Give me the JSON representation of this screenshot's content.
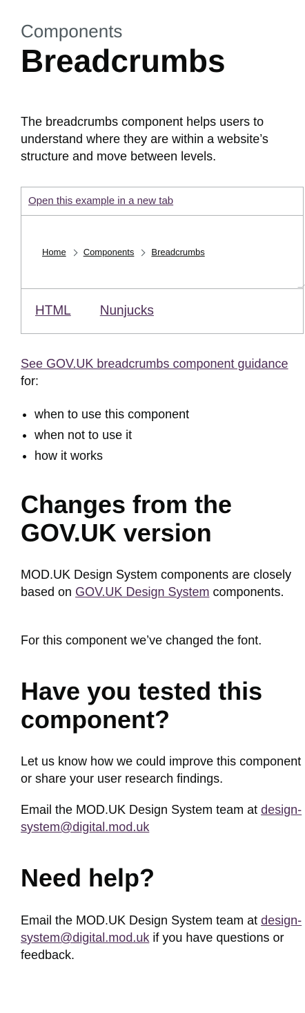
{
  "header": {
    "caption": "Components",
    "title": "Breadcrumbs"
  },
  "intro": "The breadcrumbs component helps users to understand where they are within a website’s structure and move between levels.",
  "example": {
    "open_link": "Open this example in a new tab",
    "breadcrumbs": [
      "Home",
      "Components",
      "Breadcrumbs"
    ],
    "tabs": [
      "HTML",
      "Nunjucks"
    ]
  },
  "guidance": {
    "link": "See GOV.UK breadcrumbs component guidance",
    "suffix": "for:",
    "bullets": [
      "when to use this component",
      "when not to use it",
      "how it works"
    ]
  },
  "changes": {
    "heading": "Changes from the GOV.UK version",
    "para1_before": "MOD.UK Design System components are closely based on ",
    "para1_link": "GOV.UK Design System",
    "para1_after": " components.",
    "para2": "For this component we’ve changed the font."
  },
  "tested": {
    "heading": "Have you tested this component?",
    "para1": "Let us know how we could improve this component or share your user research findings.",
    "para2_before": "Email the MOD.UK Design System team at ",
    "email": "design-system@digital.mod.uk"
  },
  "help": {
    "heading": "Need help?",
    "before": "Email the MOD.UK Design System team at ",
    "email": "design-system@digital.mod.uk",
    "after": " if you have questions or feedback."
  },
  "colors": {
    "link": "#4c2c55",
    "text": "#0b0c0c",
    "secondary_text": "#505a5f",
    "border": "#b1b4b6"
  }
}
